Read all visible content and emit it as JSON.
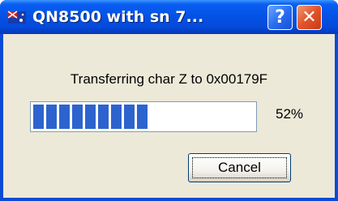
{
  "window": {
    "title": "QN8500 with sn 7...",
    "help_label": "?",
    "close_label": "✕"
  },
  "dialog": {
    "message": "Transferring char Z to 0x00179F",
    "progress_fraction": 0.52,
    "progress_text": "52%",
    "cancel_label": "Cancel"
  },
  "colors": {
    "titlebar": "#0353e6",
    "progress_block": "#2d63ce",
    "close_button": "#e2532a"
  },
  "icons": {
    "app": "app-flag-icon",
    "help": "help-icon",
    "close": "close-icon"
  }
}
